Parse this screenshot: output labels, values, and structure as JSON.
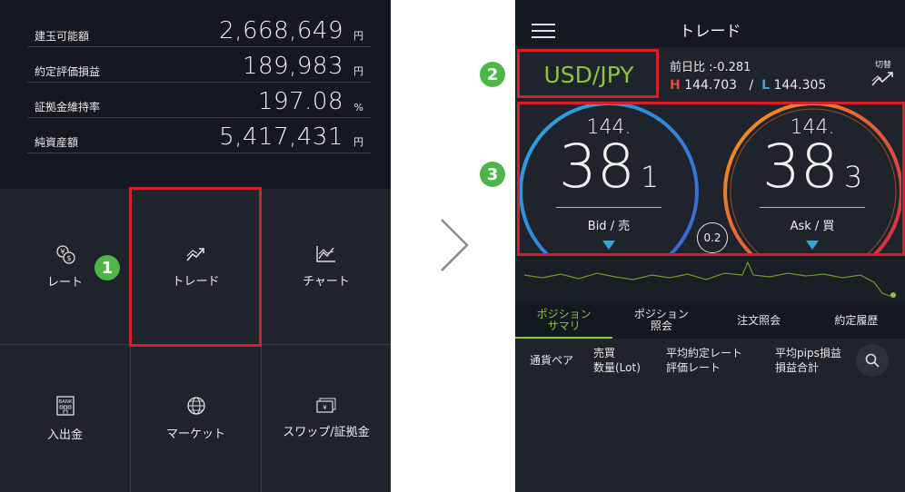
{
  "left": {
    "account": [
      {
        "label": "建玉可能額",
        "value": "2,668,649",
        "unit": "円"
      },
      {
        "label": "約定評価損益",
        "value": "189,983",
        "unit": "円"
      },
      {
        "label": "証拠金維持率",
        "value": "197.08",
        "unit": "%"
      },
      {
        "label": "純資産額",
        "value": "5,417,431",
        "unit": "円"
      }
    ],
    "menu": [
      {
        "label": "レート",
        "icon": "currency-exchange-icon"
      },
      {
        "label": "トレード",
        "icon": "trade-trend-icon"
      },
      {
        "label": "チャート",
        "icon": "chart-icon"
      },
      {
        "label": "入出金",
        "icon": "bank-icon",
        "icon_text": "BANK"
      },
      {
        "label": "マーケット",
        "icon": "globe-icon"
      },
      {
        "label": "スワップ/証拠金",
        "icon": "yen-note-icon",
        "icon_text": "¥"
      }
    ],
    "badge1": "1"
  },
  "right": {
    "title": "トレード",
    "pair": "USD/JPY",
    "day_change_label": "前日比 :",
    "day_change_value": "-0.281",
    "high_label": "H",
    "high_value": "144.703",
    "low_sep": "/",
    "low_label": "L",
    "low_value": "144.305",
    "switch_label": "切替",
    "bid": {
      "prefix": "144.",
      "main": "38",
      "small": "1",
      "label": "Bid / 売"
    },
    "ask": {
      "prefix": "144.",
      "main": "38",
      "small": "3",
      "label": "Ask / 買"
    },
    "spread": "0.2",
    "tabs": [
      {
        "line1": "ポジション",
        "line2": "サマリ"
      },
      {
        "line1": "ポジション",
        "line2": "照会"
      },
      {
        "line1": "注文照会",
        "line2": ""
      },
      {
        "line1": "約定履歴",
        "line2": ""
      }
    ],
    "columns": {
      "c1": "通貨ペア",
      "c2a": "売買",
      "c2b": "数量(Lot)",
      "c3a": "平均約定レート",
      "c3b": "評価レート",
      "c4a": "平均pips損益",
      "c4b": "損益合計"
    },
    "badge2": "2",
    "badge3": "3"
  },
  "colors": {
    "accent_green": "#8cc63f",
    "highlight_red": "#d4202a",
    "bid_blue": "#2aa9e0",
    "ask_red": "#e5493c"
  }
}
